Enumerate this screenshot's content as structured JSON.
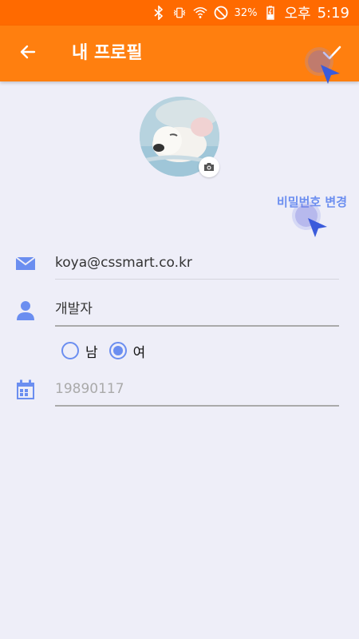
{
  "status_bar": {
    "battery_percent": "32%",
    "carrier_time_prefix": "오후",
    "time": "5:19",
    "icons": [
      "bluetooth-icon",
      "vibrate-icon",
      "wifi-icon",
      "do-not-disturb-icon",
      "battery-charging-icon"
    ]
  },
  "app_bar": {
    "title": "내 프로필",
    "back_icon": "arrow-left-icon",
    "confirm_icon": "check-icon",
    "background_color": "#ff7f0f"
  },
  "profile": {
    "avatar_alt": "profile photo",
    "camera_icon": "camera-icon"
  },
  "change_password_label": "비밀번호 변경",
  "fields": {
    "email": {
      "value": "koya@cssmart.co.kr",
      "icon": "mail-icon"
    },
    "name": {
      "value": "개발자",
      "icon": "person-icon"
    },
    "gender": {
      "options": [
        {
          "label": "남",
          "selected": false
        },
        {
          "label": "여",
          "selected": true
        }
      ]
    },
    "birthdate": {
      "placeholder": "19890117",
      "icon": "calendar-icon"
    }
  },
  "colors": {
    "accent": "#6b8ef0",
    "status_bar": "#ff6a00",
    "background": "#eeeef8"
  }
}
